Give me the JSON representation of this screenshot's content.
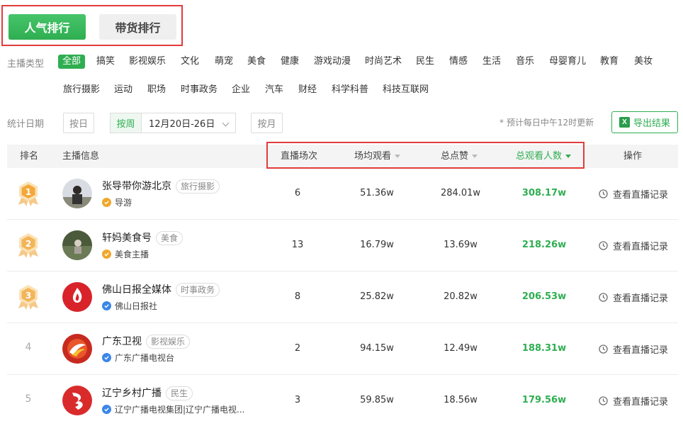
{
  "tabs": {
    "popularity": "人气排行",
    "sales": "带货排行"
  },
  "filters": {
    "category_label": "主播类型",
    "categories_row1": [
      "全部",
      "搞笑",
      "影视娱乐",
      "文化",
      "萌宠",
      "美食",
      "健康",
      "游戏动漫",
      "时尚艺术",
      "民生",
      "情感",
      "生活",
      "音乐",
      "母婴育儿",
      "教育",
      "美妆"
    ],
    "categories_row2": [
      "旅行摄影",
      "运动",
      "职场",
      "时事政务",
      "企业",
      "汽车",
      "财经",
      "科学科普",
      "科技互联网"
    ],
    "active_category": "全部",
    "date_label": "统计日期",
    "day_btn": "按日",
    "week_btn": "按周",
    "week_value": "12月20日-26日",
    "month_btn": "按月",
    "update_note": "* 预计每日中午12时更新",
    "export_btn": "导出结果"
  },
  "table": {
    "headers": {
      "rank": "排名",
      "anchor": "主播信息",
      "sessions": "直播场次",
      "avg_viewers": "场均观看",
      "likes": "总点赞",
      "total_viewers": "总观看人数",
      "action": "操作"
    },
    "rows": [
      {
        "rank": "1",
        "name": "张导带你游北京",
        "tag": "旅行摄影",
        "verified": "导游",
        "verify_color": "#f0a72b",
        "sessions": "6",
        "avg": "51.36w",
        "likes": "284.01w",
        "total": "308.17w",
        "action": "查看直播记录"
      },
      {
        "rank": "2",
        "name": "轩妈美食号",
        "tag": "美食",
        "verified": "美食主播",
        "verify_color": "#f0a72b",
        "sessions": "13",
        "avg": "16.79w",
        "likes": "13.69w",
        "total": "218.26w",
        "action": "查看直播记录"
      },
      {
        "rank": "3",
        "name": "佛山日报全媒体",
        "tag": "时事政务",
        "verified": "佛山日报社",
        "verify_color": "#3b86e8",
        "sessions": "8",
        "avg": "25.82w",
        "likes": "20.82w",
        "total": "206.53w",
        "action": "查看直播记录"
      },
      {
        "rank": "4",
        "name": "广东卫视",
        "tag": "影视娱乐",
        "verified": "广东广播电视台",
        "verify_color": "#3b86e8",
        "sessions": "2",
        "avg": "94.15w",
        "likes": "12.49w",
        "total": "188.31w",
        "action": "查看直播记录"
      },
      {
        "rank": "5",
        "name": "辽宁乡村广播",
        "tag": "民生",
        "verified": "辽宁广播电视集团|辽宁广播电视...",
        "verify_color": "#3b86e8",
        "sessions": "3",
        "avg": "59.85w",
        "likes": "18.56w",
        "total": "179.56w",
        "action": "查看直播记录"
      }
    ]
  }
}
